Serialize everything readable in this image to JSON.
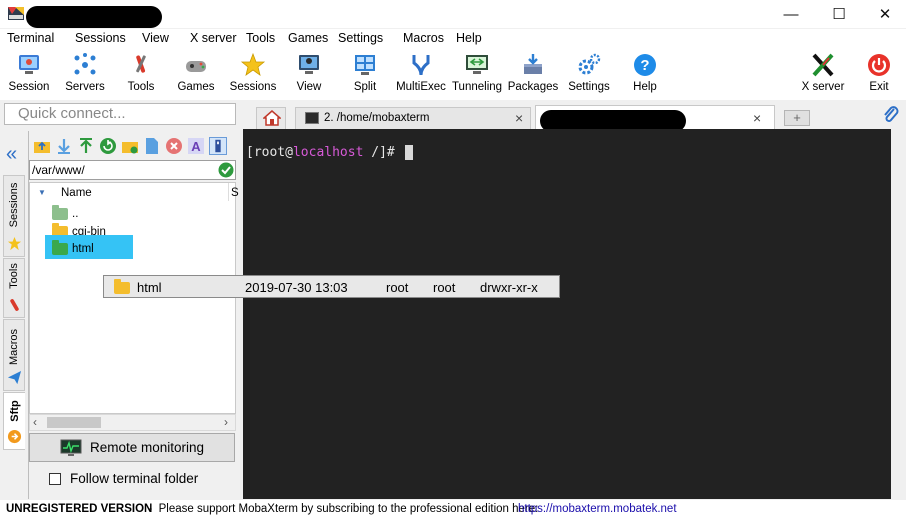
{
  "window": {
    "minimize_glyph": "—",
    "maximize_glyph": "☐",
    "close_glyph": "✕"
  },
  "menu": [
    "Terminal",
    "Sessions",
    "View",
    "X server",
    "Tools",
    "Games",
    "Settings",
    "Macros",
    "Help"
  ],
  "toolbar": {
    "session": "Session",
    "servers": "Servers",
    "tools": "Tools",
    "games": "Games",
    "sessions": "Sessions",
    "view": "View",
    "split": "Split",
    "multiexec": "MultiExec",
    "tunneling": "Tunneling",
    "packages": "Packages",
    "settings": "Settings",
    "help": "Help",
    "xserver": "X server",
    "exit": "Exit"
  },
  "quick_connect": {
    "placeholder": "Quick connect..."
  },
  "tabs": {
    "home_icon": "home-icon",
    "tab2_label": "2. /home/mobaxterm",
    "tab2_close": "×",
    "tab3_close": "×",
    "new_tab_glyph": "+"
  },
  "side_tabs": {
    "collapse_glyph": "«",
    "sessions": "Sessions",
    "tools": "Tools",
    "macros": "Macros",
    "sftp": "Sftp"
  },
  "sftp": {
    "path": "/var/www/",
    "column_name": "Name",
    "column_size_partial": "S",
    "items": [
      "..",
      "cgi-bin",
      "html"
    ],
    "remote_monitoring": "Remote monitoring",
    "follow_terminal": "Follow terminal folder"
  },
  "terminal": {
    "prompt_open": "[root@",
    "host": "localhost",
    "prompt_close": " /]# "
  },
  "drag_item": {
    "name": "html",
    "date": "2019-07-30 13:03",
    "owner": "root",
    "group": "root",
    "perms": "drwxr-xr-x"
  },
  "status": {
    "unregistered": "UNREGISTERED VERSION",
    "message": "  -  Please support MobaXterm by subscribing to the professional edition here:  ",
    "link": "https://mobaxterm.mobatek.net"
  },
  "colors": {
    "terminal_bg": "#222222",
    "host_color": "#d65ad6",
    "selection": "#35c3f5",
    "link": "#1a0dab"
  }
}
